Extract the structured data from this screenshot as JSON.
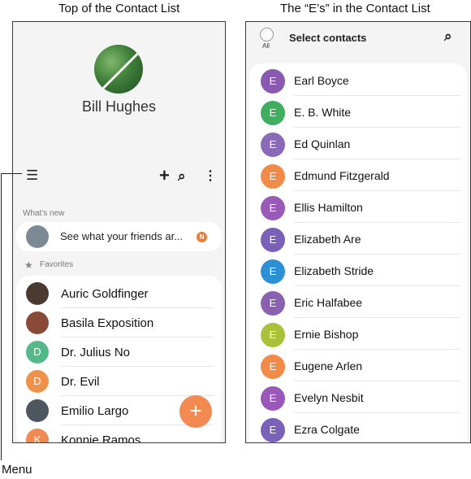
{
  "captions": {
    "left": "Top of the Contact List",
    "right": "The “E’s” in the Contact List",
    "menu": "Menu"
  },
  "profile": {
    "name": "Bill Hughes"
  },
  "toolbar": {
    "menu_icon": "☰",
    "add_icon": "+",
    "search_icon": "⌕",
    "more_icon": "⋮"
  },
  "whats_new": {
    "label": "What's new",
    "text": "See what your friends ar...",
    "badge": "N"
  },
  "favorites": {
    "label": "Favorites",
    "items": [
      {
        "name": "Auric Goldfinger",
        "initial": "",
        "color": "#4a3a30"
      },
      {
        "name": "Basila Exposition",
        "initial": "",
        "color": "#8a4a3a"
      },
      {
        "name": "Dr. Julius No",
        "initial": "D",
        "color": "#54b98a"
      },
      {
        "name": "Dr. Evil",
        "initial": "D",
        "color": "#f0914a"
      },
      {
        "name": "Emilio Largo",
        "initial": "",
        "color": "#4e5660"
      },
      {
        "name": "Konnie Ramos",
        "initial": "K",
        "color": "#f08a50"
      }
    ]
  },
  "fab": {
    "label": "+"
  },
  "select_header": {
    "all_label": "All",
    "title": "Select contacts",
    "search_icon": "⌕"
  },
  "e_contacts": [
    {
      "name": "Earl Boyce",
      "initial": "E",
      "color": "#8a5ab0"
    },
    {
      "name": "E. B. White",
      "initial": "E",
      "color": "#3fae5e"
    },
    {
      "name": "Ed Quinlan",
      "initial": "E",
      "color": "#8a6ab8"
    },
    {
      "name": "Edmund Fitzgerald",
      "initial": "E",
      "color": "#f28a4a"
    },
    {
      "name": "Ellis Hamilton",
      "initial": "E",
      "color": "#9a5ab8"
    },
    {
      "name": "Elizabeth Are",
      "initial": "E",
      "color": "#7a60b8"
    },
    {
      "name": "Elizabeth Stride",
      "initial": "E",
      "color": "#2d8fd5"
    },
    {
      "name": "Eric Halfabee",
      "initial": "E",
      "color": "#8a60b0"
    },
    {
      "name": "Ernie Bishop",
      "initial": "E",
      "color": "#a9c23a"
    },
    {
      "name": "Eugene Arlen",
      "initial": "E",
      "color": "#f28a4a"
    },
    {
      "name": "Evelyn Nesbit",
      "initial": "E",
      "color": "#9a58b8"
    },
    {
      "name": "Ezra Colgate",
      "initial": "E",
      "color": "#7a62b8"
    }
  ]
}
